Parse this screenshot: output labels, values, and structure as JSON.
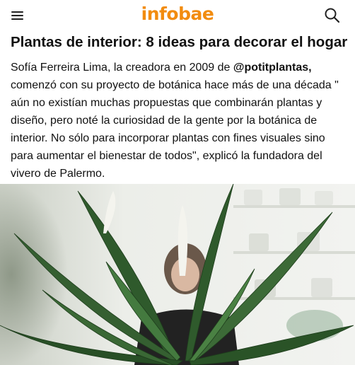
{
  "header": {
    "logo_text": "infobae",
    "logo_color": "#f28c0f",
    "menu_icon": "hamburger-menu-icon",
    "search_icon": "search-icon"
  },
  "article": {
    "headline": "Plantas de interior: 8 ideas para decorar el hogar",
    "body_intro": "Sofía Ferreira Lima, la creadora en 2009 de ",
    "body_handle": "@potitplantas,",
    "body_rest": " comenzó con su proyecto de botánica hace más de una década \" aún no existían muchas propuestas que combinarán plantas y diseño, pero noté la curiosidad de la gente por la botánica de interior. No sólo para incorporar plantas con fines visuales sino para aumentar el bienestar de todos\", explicó la fundadora del vivero de Palermo."
  }
}
